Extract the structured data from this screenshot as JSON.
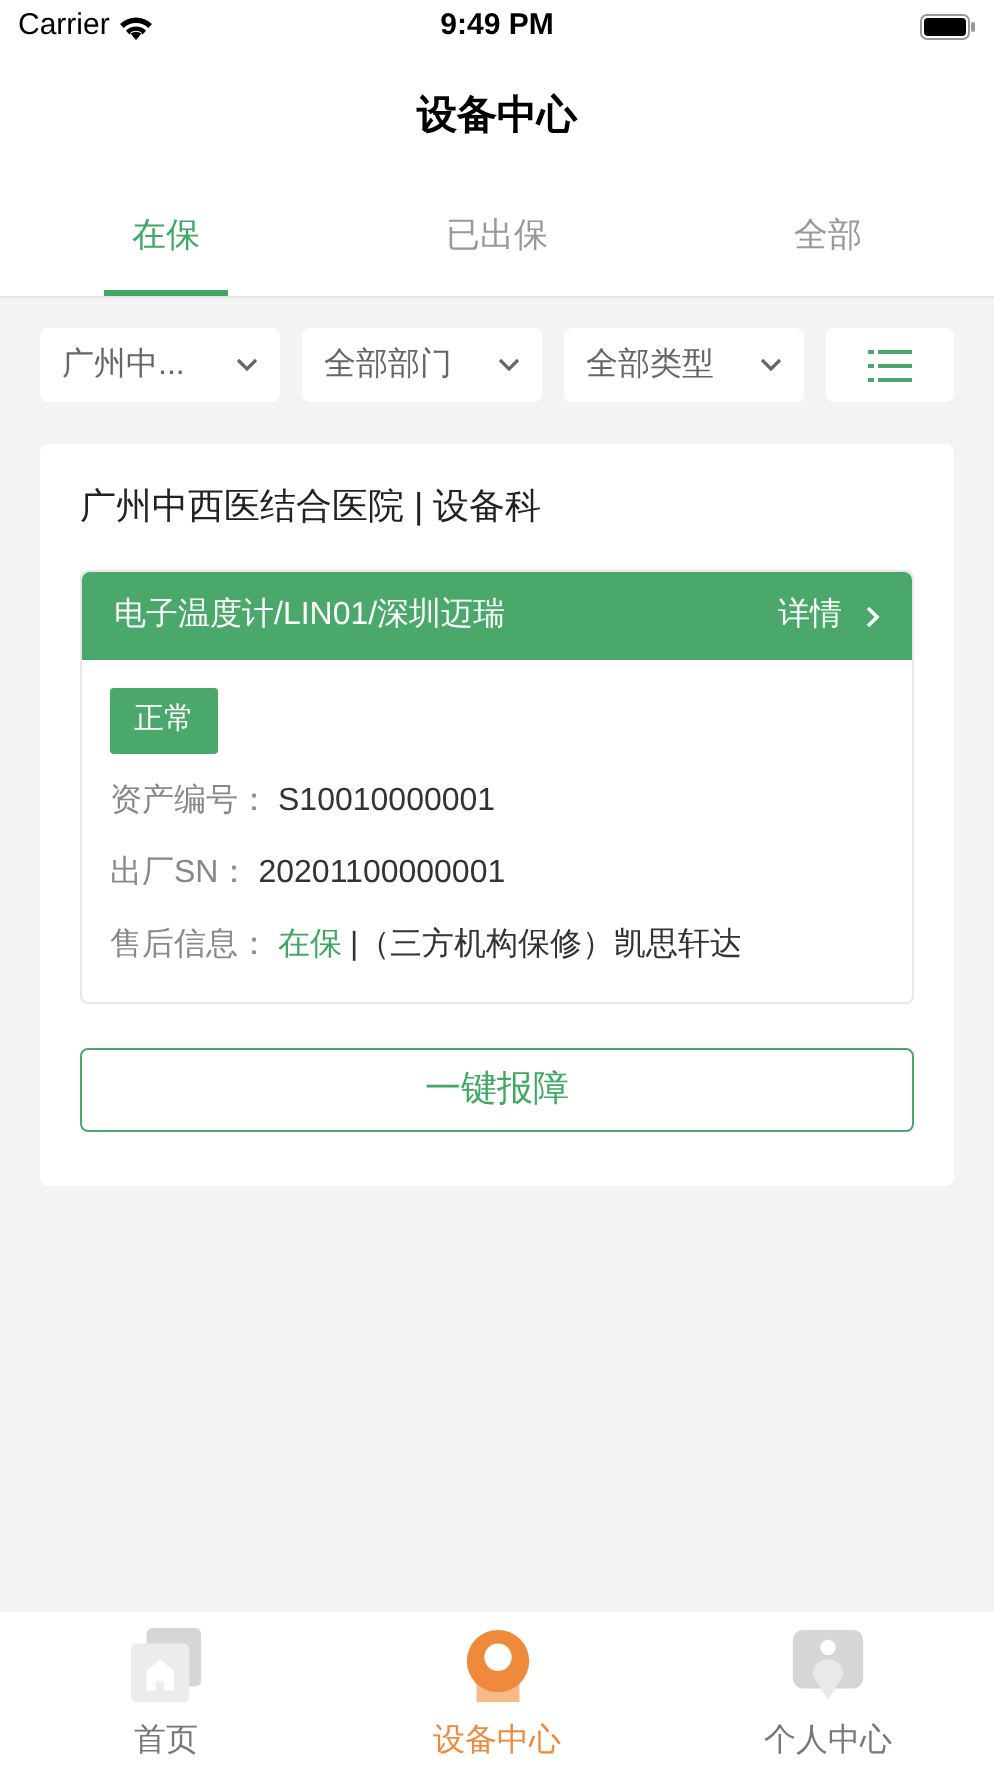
{
  "status_bar": {
    "carrier": "Carrier",
    "time": "9:49 PM"
  },
  "title": "设备中心",
  "tabs": [
    {
      "label": "在保",
      "selected": true
    },
    {
      "label": "已出保",
      "selected": false
    },
    {
      "label": "全部",
      "selected": false
    }
  ],
  "filters": [
    {
      "label": "广州中..."
    },
    {
      "label": "全部部门"
    },
    {
      "label": "全部类型"
    }
  ],
  "device_card": {
    "hospital": "广州中西医结合医院 | 设备科",
    "device": "电子温度计/LIN01/深圳迈瑞",
    "detail_link": "详情",
    "status_badge": "正常",
    "fields": [
      {
        "label": "资产编号：",
        "value": "S10010000001"
      },
      {
        "label": "出厂SN：",
        "value": "20201100000001"
      }
    ],
    "after_sales": {
      "label": "售后信息：",
      "warranty": "在保",
      "rest": "|（三方机构保修）凯思轩达"
    },
    "report_button": "一键报障"
  },
  "nav": [
    {
      "kind": "home",
      "label": "首页",
      "selected": false
    },
    {
      "kind": "device",
      "label": "设备中心",
      "selected": true
    },
    {
      "kind": "person",
      "label": "个人中心",
      "selected": false
    }
  ]
}
